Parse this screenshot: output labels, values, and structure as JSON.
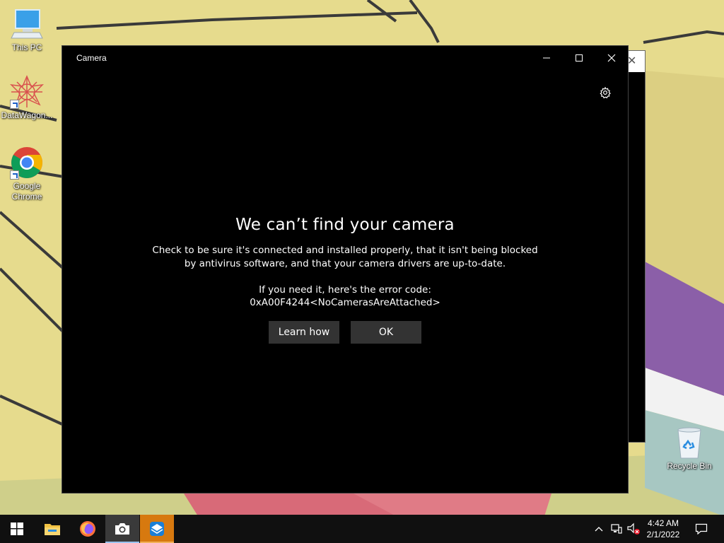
{
  "desktop": {
    "icons": [
      {
        "label": "This PC",
        "icon": "this-pc-icon"
      },
      {
        "label": "DataWagon...",
        "icon": "datawagon-icon"
      },
      {
        "label": "Google Chrome",
        "icon": "chrome-icon"
      },
      {
        "label": "Recycle Bin",
        "icon": "recycle-bin-icon"
      }
    ]
  },
  "camera_window": {
    "title": "Camera",
    "error": {
      "heading": "We can’t find your camera",
      "body_line1": "Check to be sure it's connected and installed properly, that it isn't being blocked",
      "body_line2": "by antivirus software, and that your camera drivers are up-to-date.",
      "code_intro": "If you need it, here's the error code:",
      "code": "0xA00F4244<NoCamerasAreAttached>"
    },
    "buttons": {
      "learn_how": "Learn how",
      "ok": "OK"
    }
  },
  "taskbar": {
    "items": [
      "start-icon",
      "file-explorer-icon",
      "firefox-icon",
      "camera-icon",
      "app-icon"
    ],
    "clock": {
      "time": "4:42 AM",
      "date": "2/1/2022"
    }
  },
  "colors": {
    "taskbar_bg": "#101010",
    "window_bg": "#000000",
    "button_bg": "#333333",
    "wallpaper": "#e4d98a",
    "running_app_accent": "#d7790f"
  }
}
